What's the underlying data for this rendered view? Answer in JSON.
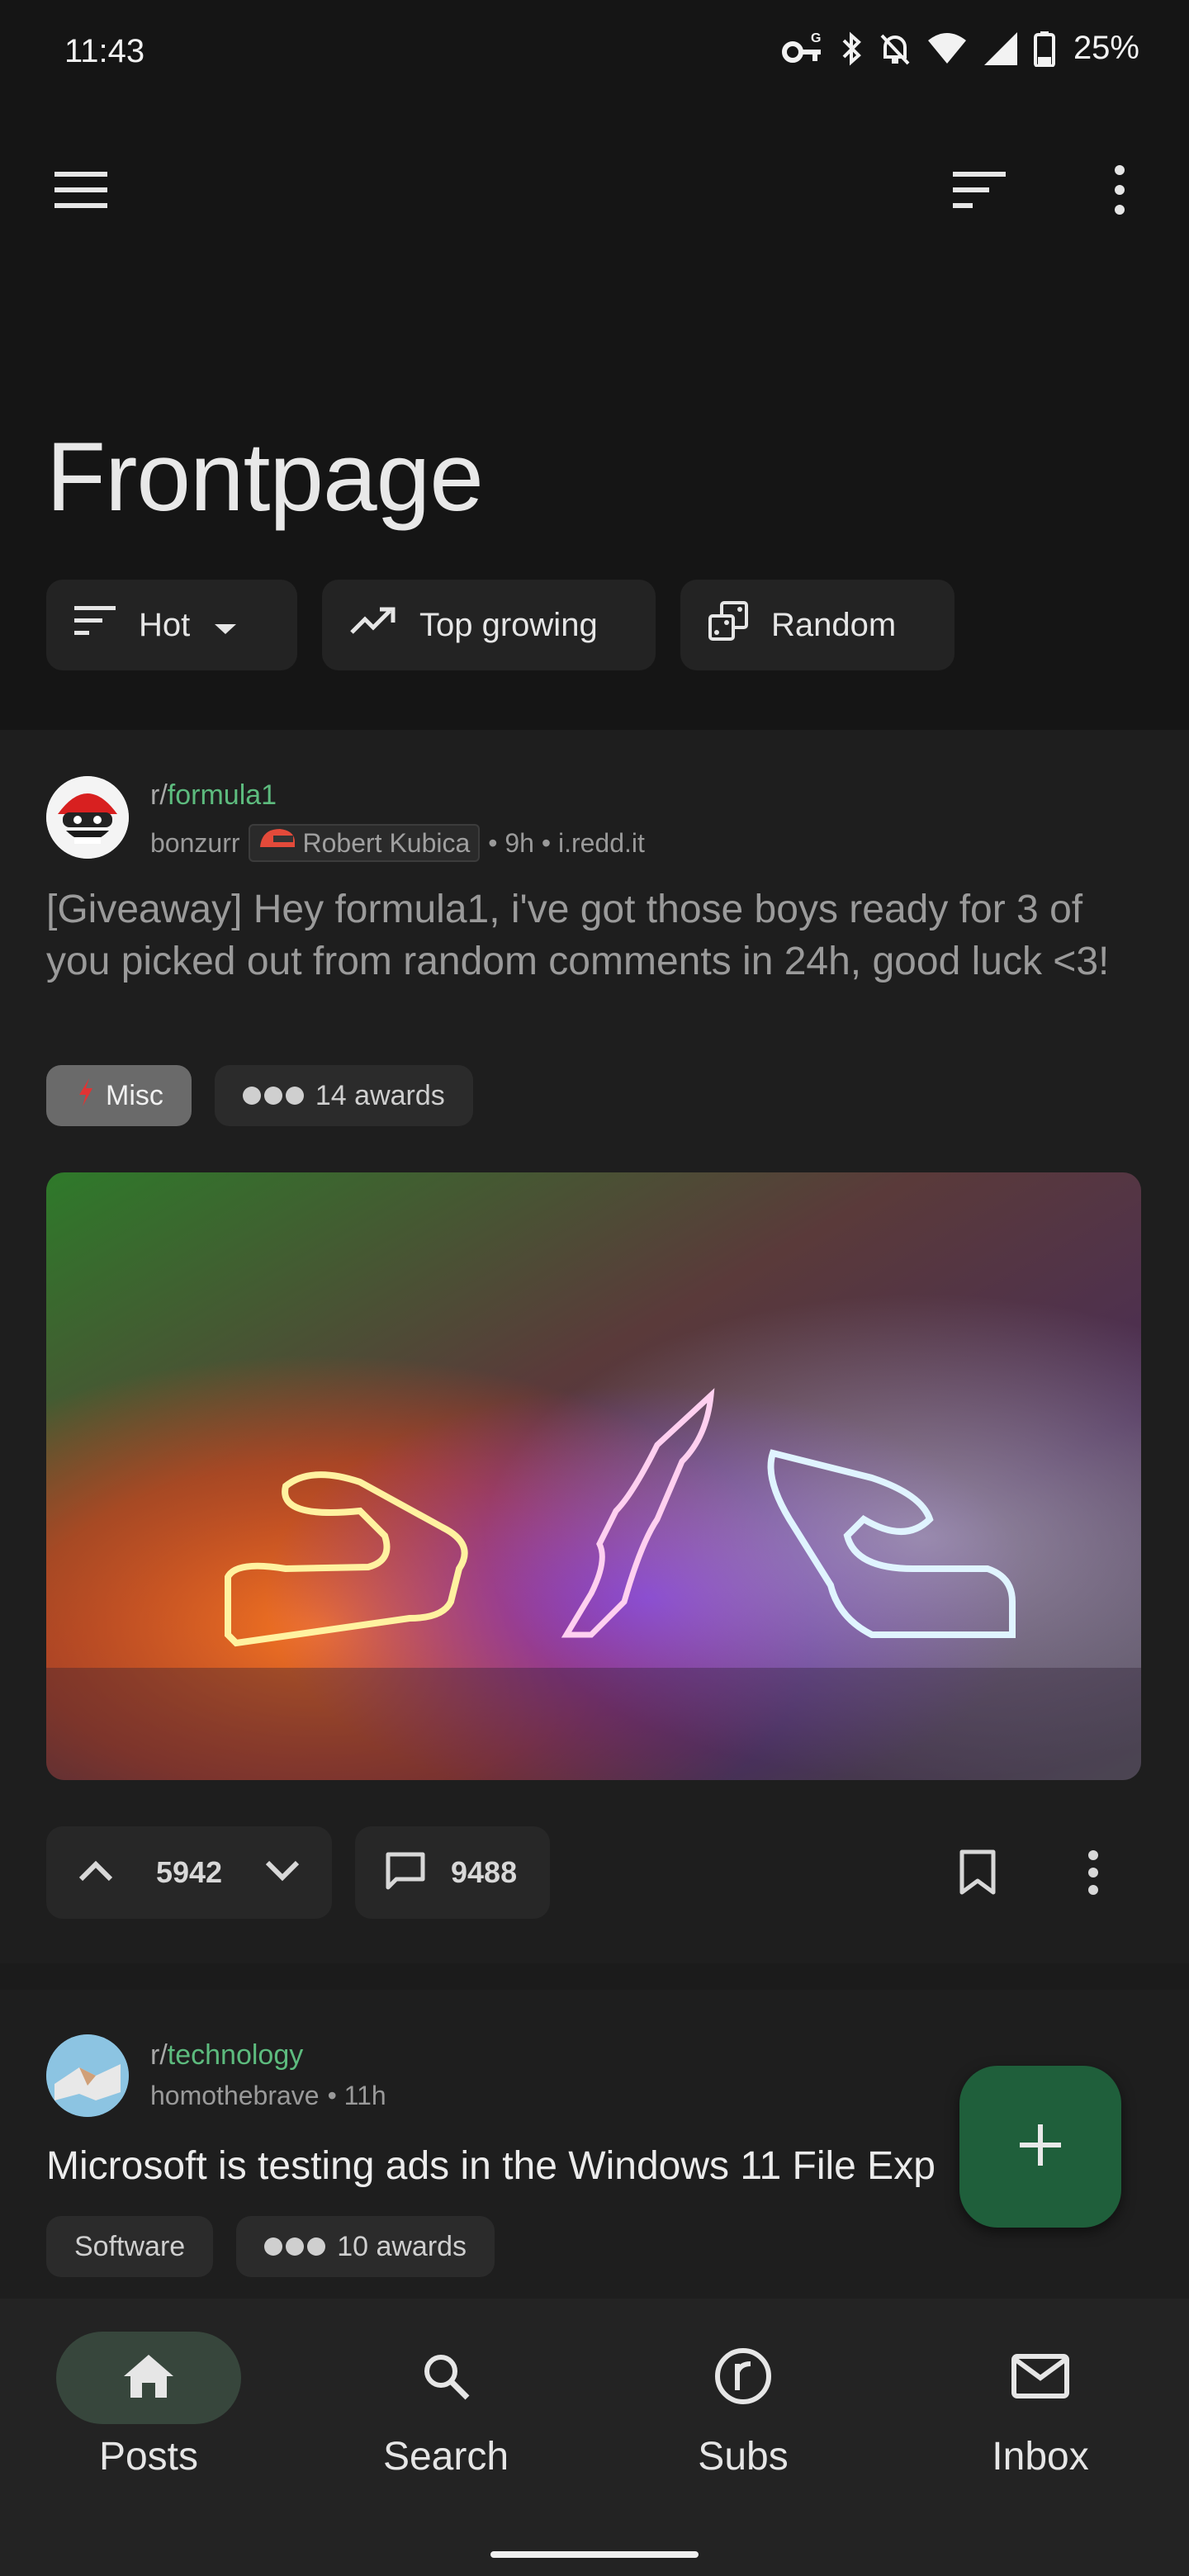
{
  "status_bar": {
    "time": "11:43",
    "battery": "25%"
  },
  "app_bar": {
    "menu_icon": "menu-icon",
    "sort_icon": "sort-icon",
    "more_icon": "more-vert-icon"
  },
  "page": {
    "title": "Frontpage"
  },
  "chips": {
    "hot": "Hot",
    "top_growing": "Top growing",
    "random": "Random"
  },
  "posts": [
    {
      "subreddit_prefix": "r/",
      "subreddit": "formula1",
      "author": "bonzurr",
      "author_flair": "Robert Kubica",
      "meta": "• 9h • i.redd.it",
      "title": "[Giveaway] Hey formula1, i've got those boys ready for 3 of you picked out from random comments in 24h, good luck <3!",
      "flair": "Misc",
      "awards": "14 awards",
      "score": "5942",
      "comments": "9488"
    },
    {
      "subreddit_prefix": "r/",
      "subreddit": "technology",
      "author": "homothebrave",
      "meta": "• 11h",
      "title": "Microsoft is testing ads in the Windows 11 File Exp",
      "flair": "Software",
      "awards": "10 awards"
    }
  ],
  "bottom_nav": {
    "posts": "Posts",
    "search": "Search",
    "subs": "Subs",
    "inbox": "Inbox"
  },
  "colors": {
    "accent_green": "#5dbb7e",
    "fab": "#1f5f3b",
    "nav_active": "#37463c"
  }
}
